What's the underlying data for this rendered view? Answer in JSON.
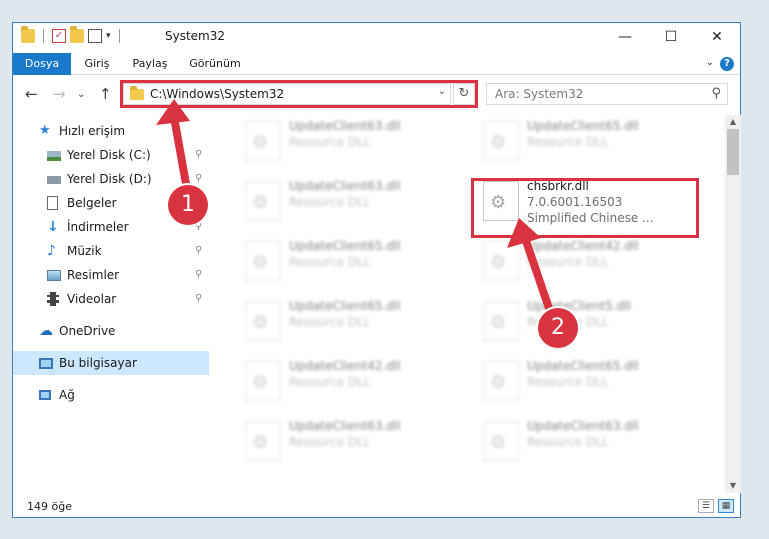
{
  "window": {
    "title": "System32",
    "controls": {
      "minimize": "—",
      "maximize": "☐",
      "close": "✕"
    }
  },
  "ribbon": {
    "tabs": [
      "Dosya",
      "Giriş",
      "Paylaş",
      "Görünüm"
    ],
    "help": "?",
    "collapse": "⌄"
  },
  "nav": {
    "back": "←",
    "forward": "→",
    "dropdown": "⌄",
    "up": "↑",
    "address": "C:\\Windows\\System32",
    "address_dropdown": "⌄",
    "refresh": "↻",
    "search_placeholder": "Ara: System32",
    "search_icon": "⚲"
  },
  "sidebar": {
    "items": [
      {
        "label": "Hızlı erişim",
        "icon": "star-icon",
        "pinned": false
      },
      {
        "label": "Yerel Disk (C:)",
        "icon": "drive-icon",
        "pinned": true
      },
      {
        "label": "Yerel Disk (D:)",
        "icon": "drive-icon",
        "pinned": true
      },
      {
        "label": "Belgeler",
        "icon": "documents-icon",
        "pinned": true
      },
      {
        "label": "İndirmeler",
        "icon": "download-icon",
        "pinned": true
      },
      {
        "label": "Müzik",
        "icon": "music-icon",
        "pinned": true
      },
      {
        "label": "Resimler",
        "icon": "pictures-icon",
        "pinned": true
      },
      {
        "label": "Videolar",
        "icon": "videos-icon",
        "pinned": true
      },
      {
        "label": "OneDrive",
        "icon": "cloud-icon",
        "pinned": false
      },
      {
        "label": "Bu bilgisayar",
        "icon": "computer-icon",
        "pinned": false,
        "selected": true
      },
      {
        "label": "Ağ",
        "icon": "network-icon",
        "pinned": false
      }
    ],
    "pin_glyph": "📌"
  },
  "files": {
    "left_column": [
      {
        "name": "UpdateClient63.dll",
        "desc": "Resource DLL"
      },
      {
        "name": "UpdateClient63.dll",
        "desc": "Resource DLL"
      },
      {
        "name": "UpdateClient65.dll",
        "desc": "Resource DLL"
      },
      {
        "name": "UpdateClient65.dll",
        "desc": "Resource DLL"
      },
      {
        "name": "UpdateClient42.dll",
        "desc": "Resource DLL"
      },
      {
        "name": "UpdateClient63.dll",
        "desc": "Resource DLL"
      }
    ],
    "right_column": [
      {
        "name": "UpdateClient65.dll",
        "desc": "Resource DLL"
      },
      {
        "name": "chsbrkr.dll",
        "version": "7.0.6001.16503",
        "desc": "Simplified Chinese ...",
        "highlighted": true
      },
      {
        "name": "UpdateClient42.dll",
        "desc": "Resource DLL"
      },
      {
        "name": "UpdateClient5.dll",
        "desc": "Resource DLL"
      },
      {
        "name": "UpdateClient65.dll",
        "desc": "Resource DLL"
      },
      {
        "name": "UpdateClient63.dll",
        "desc": "Resource DLL"
      }
    ]
  },
  "status": {
    "item_count": "149 öğe"
  },
  "callouts": {
    "one": "1",
    "two": "2"
  },
  "colors": {
    "accent": "#1979ca",
    "highlight": "#d9333f",
    "selected_bg": "#cce8ff"
  }
}
